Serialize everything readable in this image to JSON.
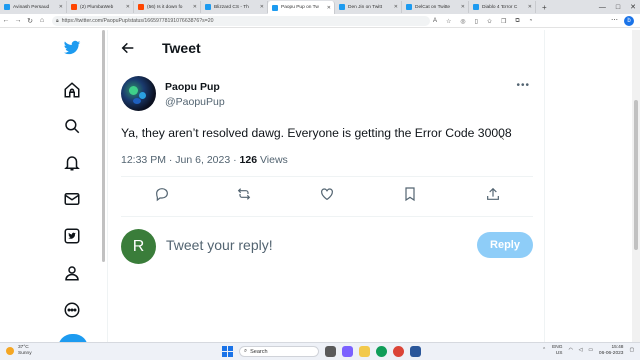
{
  "browser": {
    "tabs": [
      {
        "title": "Avinash Persaud",
        "color": "#1d9bf0"
      },
      {
        "title": "(2) PlumbaWeb",
        "color": "#ff4500"
      },
      {
        "title": "(56) Is it down fo",
        "color": "#ff4500"
      },
      {
        "title": "Blizzard CS - Th",
        "color": "#1d9bf0"
      },
      {
        "title": "Paopu Pup on Tw",
        "color": "#1d9bf0",
        "active": true
      },
      {
        "title": "Den Jin on Twitt",
        "color": "#1d9bf0"
      },
      {
        "title": "DelCat on Twitte",
        "color": "#1d9bf0"
      },
      {
        "title": "Diablo 4 'Error C",
        "color": "#1d9bf0"
      }
    ],
    "url": "https://twitter.com/PaopuPup/status/1665977819107663876?s=20",
    "new_tab": "+",
    "window_controls": [
      "—",
      "□",
      "✕"
    ]
  },
  "page": {
    "header_title": "Tweet",
    "author": {
      "display_name": "Paopu Pup",
      "handle": "@PaopuPup"
    },
    "tweet_text": "Ya, they aren’t resolved dawg. Everyone is getting the Error Code 30008",
    "meta": {
      "time": "12:33 PM",
      "sep": " · ",
      "date": "Jun 6, 2023",
      "sep2": " · ",
      "views_count": "126",
      "views_label": " Views"
    },
    "reply": {
      "avatar_letter": "R",
      "placeholder": "Tweet your reply!",
      "button_label": "Reply"
    },
    "more_icon": "•••"
  },
  "taskbar": {
    "weather_temp": "37°C",
    "weather_desc": "Sunny",
    "search_label": "Search",
    "lang_1": "ENG",
    "lang_2": "US",
    "time": "15:48",
    "date": "06-06-2023"
  },
  "colors": {
    "accent": "#1d9bf0",
    "reply_button": "#8ecdf8",
    "reply_avatar": "#3a7d3a"
  }
}
